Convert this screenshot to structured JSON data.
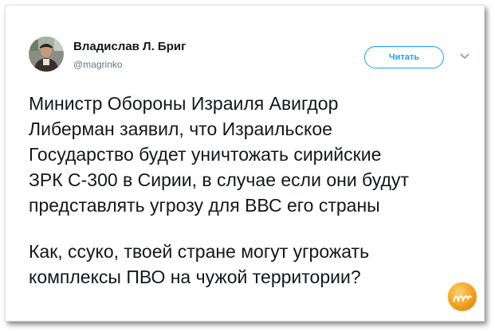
{
  "author": {
    "name": "Владислав Л. Бриг",
    "handle": "@magrinko"
  },
  "follow_button": {
    "label": "Читать"
  },
  "tweet": {
    "paragraph1_lines": [
      "Министр Обороны Израиля Авигдор",
      "Либерман заявил, что Израильское",
      "Государство будет уничтожать сирийские",
      "ЗРК С-300 в Сирии, в случае если они будут",
      "представлять угрозу для ВВС его страны"
    ],
    "paragraph2_lines": [
      "Как, ссуко, твоей стране могут угрожать",
      "комплексы ПВО на чужой территории?"
    ]
  },
  "icons": {
    "menu": "chevron-down-icon",
    "avatar": "avatar",
    "watermark": "site-logo"
  },
  "colors": {
    "accent": "#1da1f2",
    "text": "#14171a",
    "muted": "#657786",
    "logo": "#f5a623"
  }
}
